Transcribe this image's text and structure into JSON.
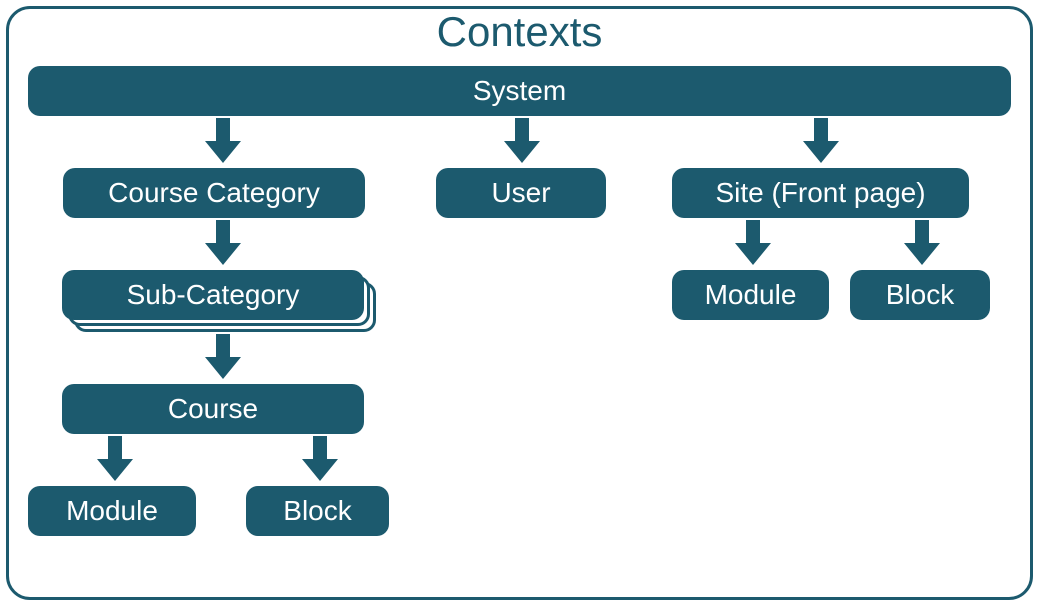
{
  "title": "Contexts",
  "nodes": {
    "system": "System",
    "course_category": "Course Category",
    "user": "User",
    "site": "Site (Front page)",
    "sub_category": "Sub-Category",
    "module_site": "Module",
    "block_site": "Block",
    "course": "Course",
    "module_course": "Module",
    "block_course": "Block"
  },
  "colors": {
    "primary": "#1c5a6e",
    "text_on_primary": "#ffffff"
  },
  "structure": {
    "root": "system",
    "children": {
      "system": [
        "course_category",
        "user",
        "site"
      ],
      "course_category": [
        "sub_category"
      ],
      "sub_category": [
        "course"
      ],
      "course": [
        "module_course",
        "block_course"
      ],
      "site": [
        "module_site",
        "block_site"
      ]
    },
    "note": "sub_category is shown as a stack (repeatable)"
  }
}
